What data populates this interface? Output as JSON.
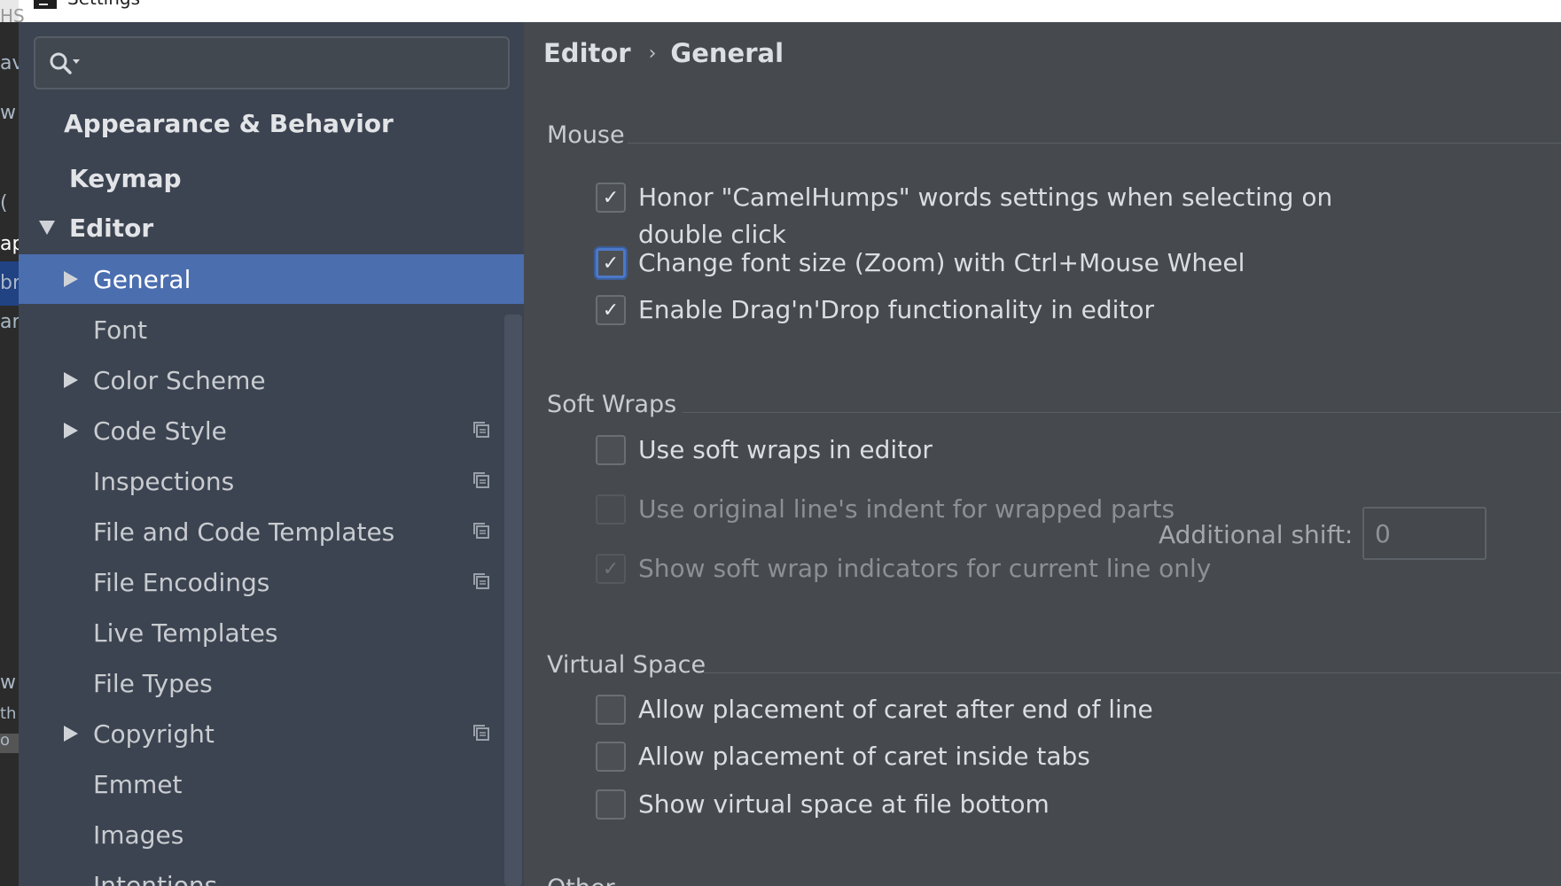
{
  "window": {
    "title": "Settings"
  },
  "background_editor": {
    "fragments": [
      "HS",
      "av",
      "w",
      "(",
      "ap",
      "br",
      "ar",
      "w",
      "th",
      "o"
    ]
  },
  "search": {
    "value": "",
    "placeholder": ""
  },
  "sidebar": {
    "items": [
      {
        "label": "Appearance & Behavior",
        "level": 0,
        "expandable": false,
        "expanded": false,
        "selected": false,
        "has_copy_icon": false
      },
      {
        "label": "Keymap",
        "level": 0,
        "expandable": false,
        "expanded": false,
        "selected": false,
        "has_copy_icon": false
      },
      {
        "label": "Editor",
        "level": 0,
        "expandable": true,
        "expanded": true,
        "selected": false,
        "has_copy_icon": false
      },
      {
        "label": "General",
        "level": 1,
        "expandable": true,
        "expanded": false,
        "selected": true,
        "has_copy_icon": false
      },
      {
        "label": "Font",
        "level": 1,
        "expandable": false,
        "expanded": false,
        "selected": false,
        "has_copy_icon": false
      },
      {
        "label": "Color Scheme",
        "level": 1,
        "expandable": true,
        "expanded": false,
        "selected": false,
        "has_copy_icon": false
      },
      {
        "label": "Code Style",
        "level": 1,
        "expandable": true,
        "expanded": false,
        "selected": false,
        "has_copy_icon": true
      },
      {
        "label": "Inspections",
        "level": 1,
        "expandable": false,
        "expanded": false,
        "selected": false,
        "has_copy_icon": true
      },
      {
        "label": "File and Code Templates",
        "level": 1,
        "expandable": false,
        "expanded": false,
        "selected": false,
        "has_copy_icon": true
      },
      {
        "label": "File Encodings",
        "level": 1,
        "expandable": false,
        "expanded": false,
        "selected": false,
        "has_copy_icon": true
      },
      {
        "label": "Live Templates",
        "level": 1,
        "expandable": false,
        "expanded": false,
        "selected": false,
        "has_copy_icon": false
      },
      {
        "label": "File Types",
        "level": 1,
        "expandable": false,
        "expanded": false,
        "selected": false,
        "has_copy_icon": false
      },
      {
        "label": "Copyright",
        "level": 1,
        "expandable": true,
        "expanded": false,
        "selected": false,
        "has_copy_icon": true
      },
      {
        "label": "Emmet",
        "level": 1,
        "expandable": false,
        "expanded": false,
        "selected": false,
        "has_copy_icon": false
      },
      {
        "label": "Images",
        "level": 1,
        "expandable": false,
        "expanded": false,
        "selected": false,
        "has_copy_icon": false
      },
      {
        "label": "Intentions",
        "level": 1,
        "expandable": false,
        "expanded": false,
        "selected": false,
        "has_copy_icon": false
      }
    ]
  },
  "breadcrumb": {
    "parent": "Editor",
    "separator": "›",
    "current": "General"
  },
  "sections": {
    "mouse": {
      "title": "Mouse",
      "options": [
        {
          "label_line1": "Honor \"CamelHumps\" words settings when selecting on",
          "label_line2": "double click",
          "checked": true,
          "enabled": true,
          "focused": false
        },
        {
          "label_line1": "Change font size (Zoom) with Ctrl+Mouse Wheel",
          "label_line2": "",
          "checked": true,
          "enabled": true,
          "focused": true
        },
        {
          "label_line1": "Enable Drag'n'Drop functionality in editor",
          "label_line2": "",
          "checked": true,
          "enabled": true,
          "focused": false
        }
      ]
    },
    "soft_wraps": {
      "title": "Soft Wraps",
      "options": [
        {
          "label": "Use soft wraps in editor",
          "checked": false,
          "enabled": true
        },
        {
          "label": "Use original line's indent for wrapped parts",
          "checked": false,
          "enabled": false
        },
        {
          "label": "Show soft wrap indicators for current line only",
          "checked": true,
          "enabled": false
        }
      ],
      "additional_shift_label": "Additional shift:",
      "additional_shift_value": "0"
    },
    "virtual_space": {
      "title": "Virtual Space",
      "options": [
        {
          "label": "Allow placement of caret after end of line",
          "checked": false,
          "enabled": true
        },
        {
          "label": "Allow placement of caret inside tabs",
          "checked": false,
          "enabled": true
        },
        {
          "label": "Show virtual space at file bottom",
          "checked": false,
          "enabled": true
        }
      ]
    },
    "other": {
      "title": "Other"
    }
  },
  "colors": {
    "selection": "#4b6eaf",
    "focus_ring": "#4c78c8",
    "sidebar_bg": "#3c4451",
    "panel_bg": "#464a4f"
  }
}
